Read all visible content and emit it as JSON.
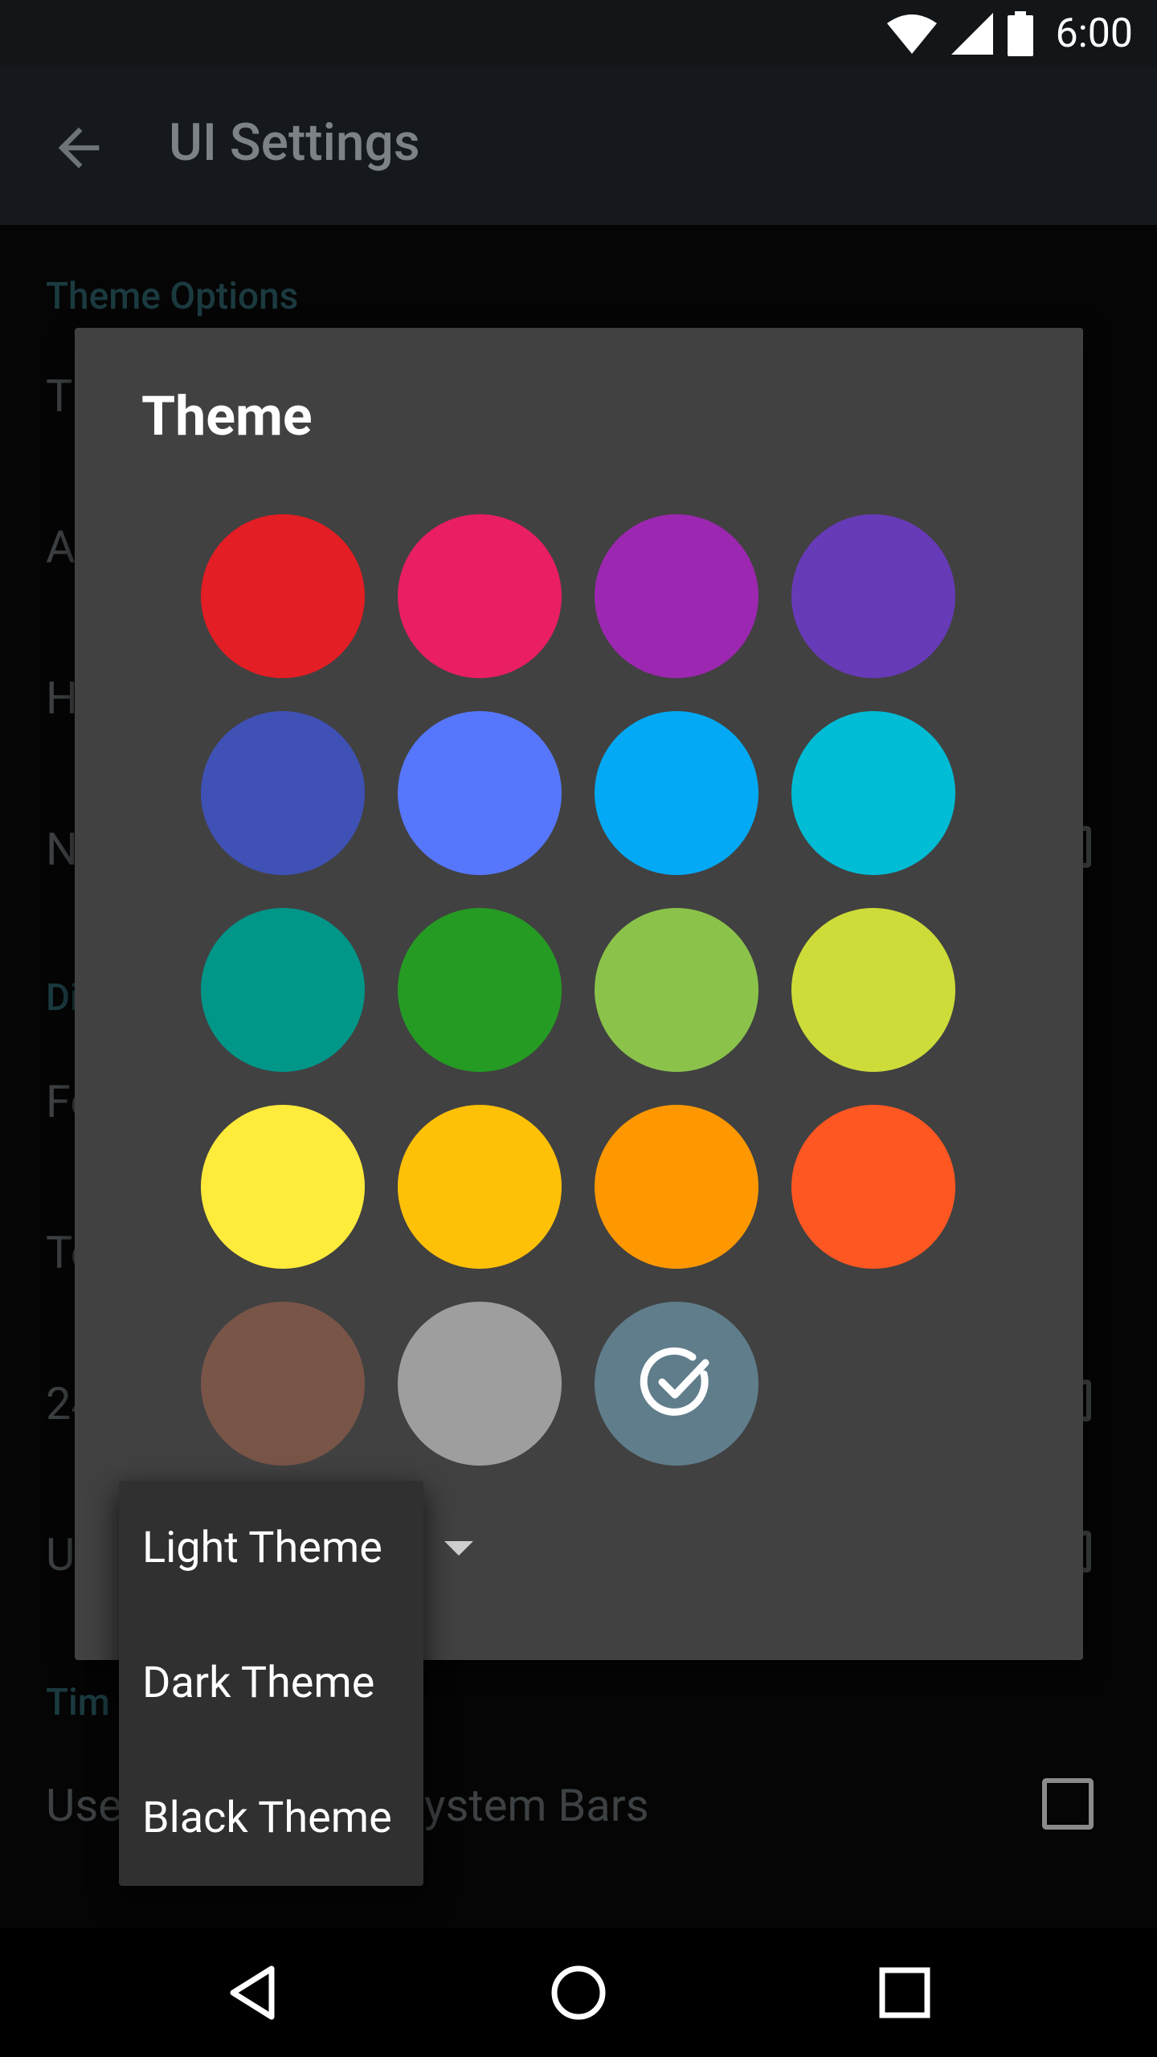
{
  "status_bar": {
    "time": "6:00",
    "icons": [
      "wifi-icon",
      "cellular-signal-icon",
      "battery-icon"
    ]
  },
  "app_bar": {
    "title": "UI Settings",
    "back_icon": "arrow-back-icon"
  },
  "background": {
    "section_theme_options": "Theme Options",
    "section_display_partial": "Di",
    "section_time_partial": "Tim",
    "items_partial": [
      "T",
      "A",
      "H",
      "N",
      "Fo",
      "Te",
      "24",
      "U"
    ],
    "item_system_bars_start": "Use",
    "item_system_bars_end": "ystem Bars"
  },
  "dialog": {
    "title": "Theme",
    "swatches": [
      {
        "name": "red",
        "color": "#E31E24"
      },
      {
        "name": "pink",
        "color": "#E91E63"
      },
      {
        "name": "purple",
        "color": "#9C27B0"
      },
      {
        "name": "deep-purple",
        "color": "#673AB7"
      },
      {
        "name": "indigo",
        "color": "#3F51B5"
      },
      {
        "name": "blue",
        "color": "#5677FC"
      },
      {
        "name": "light-blue",
        "color": "#03A9F4"
      },
      {
        "name": "cyan",
        "color": "#00BCD4"
      },
      {
        "name": "teal",
        "color": "#009688"
      },
      {
        "name": "green",
        "color": "#259B24"
      },
      {
        "name": "light-green",
        "color": "#8BC34A"
      },
      {
        "name": "lime",
        "color": "#CDDC39"
      },
      {
        "name": "yellow",
        "color": "#FFEB3B"
      },
      {
        "name": "amber",
        "color": "#FFC107"
      },
      {
        "name": "orange",
        "color": "#FF9800"
      },
      {
        "name": "deep-orange",
        "color": "#FF5722"
      },
      {
        "name": "brown",
        "color": "#795548"
      },
      {
        "name": "grey",
        "color": "#9E9E9E"
      },
      {
        "name": "blue-grey",
        "color": "#607D8B",
        "selected": true
      }
    ],
    "selected_icon": "check-circle-icon",
    "dropdown_icon": "dropdown-arrow-icon"
  },
  "theme_menu": {
    "options": [
      "Light Theme",
      "Dark Theme",
      "Black Theme"
    ]
  },
  "nav_bar": {
    "icons": [
      "back-triangle-icon",
      "home-circle-icon",
      "recents-square-icon"
    ]
  }
}
